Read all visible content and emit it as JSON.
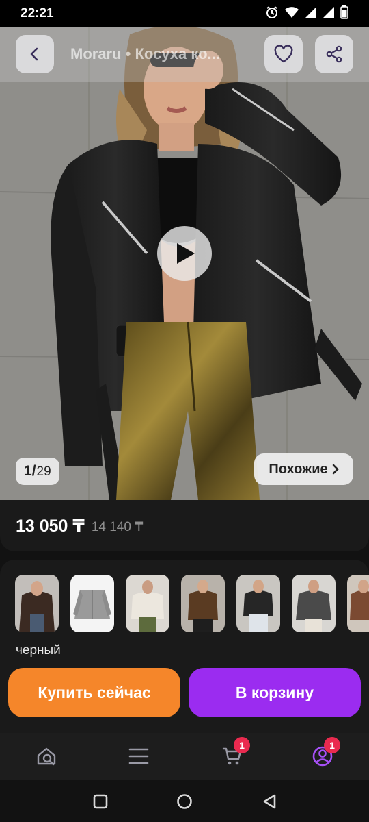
{
  "status_bar": {
    "time": "22:21",
    "icons": [
      "alarm-icon",
      "wifi-icon",
      "signal-icon",
      "signal-icon",
      "battery-icon"
    ]
  },
  "header": {
    "title": "Moraru • Косуха ко...",
    "back_icon": "chevron-left-icon",
    "favorite_icon": "heart-icon",
    "share_icon": "share-icon"
  },
  "gallery": {
    "current": "1",
    "separator": "/",
    "total": "29",
    "similar_label": "Похожие",
    "similar_icon": "chevron-right-icon",
    "play_icon": "play-icon"
  },
  "price": {
    "current": "13 050 ₸",
    "old": "14 140 ₸"
  },
  "variants": {
    "selected_color": "черный",
    "thumbnails": [
      {
        "name": "black-jacket",
        "bg": "#3b2f2a",
        "selected": true
      },
      {
        "name": "grey-jacket-flat",
        "bg": "#f2f2f2"
      },
      {
        "name": "white-jacket",
        "bg": "#cfc9bf"
      },
      {
        "name": "brown-jacket",
        "bg": "#8a6a4a"
      },
      {
        "name": "black-jacket-2",
        "bg": "#b9b4ad"
      },
      {
        "name": "grey-jacket",
        "bg": "#8f8c88"
      },
      {
        "name": "brown-jacket-2",
        "bg": "#9a7a62"
      }
    ]
  },
  "actions": {
    "buy_now": "Купить сейчас",
    "add_to_cart": "В корзину",
    "buy_color": "#f5862a",
    "cart_color": "#9b2cf0"
  },
  "bottom_nav": {
    "items": [
      {
        "name": "home-search-icon"
      },
      {
        "name": "catalog-menu-icon"
      },
      {
        "name": "cart-icon",
        "badge": "1"
      },
      {
        "name": "profile-icon",
        "badge": "1"
      }
    ],
    "badge_color": "#ea2a4f",
    "active_color": "#a650f5"
  },
  "system_nav": [
    "recents-icon",
    "home-icon",
    "back-icon"
  ]
}
